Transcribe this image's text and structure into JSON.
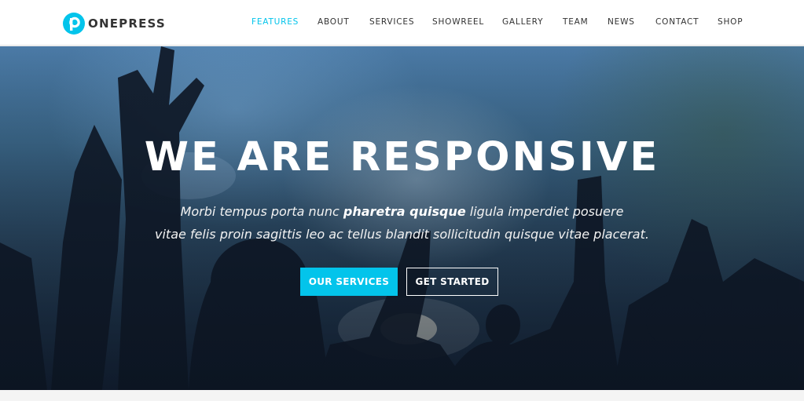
{
  "brand": {
    "name": "ONEPRESS",
    "accent_color": "#03c4eb",
    "logo_icon": "p-letter-circle-icon"
  },
  "nav": {
    "items": [
      {
        "label": "FEATURES",
        "active": true
      },
      {
        "label": "ABOUT",
        "active": false
      },
      {
        "label": "SERVICES",
        "active": false
      },
      {
        "label": "SHOWREEL",
        "active": false
      },
      {
        "label": "GALLERY",
        "active": false
      },
      {
        "label": "TEAM",
        "active": false
      },
      {
        "label": "NEWS",
        "active": false
      },
      {
        "label": "CONTACT",
        "active": false
      },
      {
        "label": "SHOP",
        "active": false
      }
    ]
  },
  "hero": {
    "title": "WE ARE RESPONSIVE",
    "text_line1_before": "Morbi tempus porta nunc ",
    "text_line1_bold": "pharetra quisque",
    "text_line1_after": " ligula imperdiet posuere",
    "text_line2": "vitae felis proin sagittis leo ac tellus blandit sollicitudin quisque vitae placerat.",
    "primary_button": "OUR SERVICES",
    "secondary_button": "GET STARTED"
  }
}
